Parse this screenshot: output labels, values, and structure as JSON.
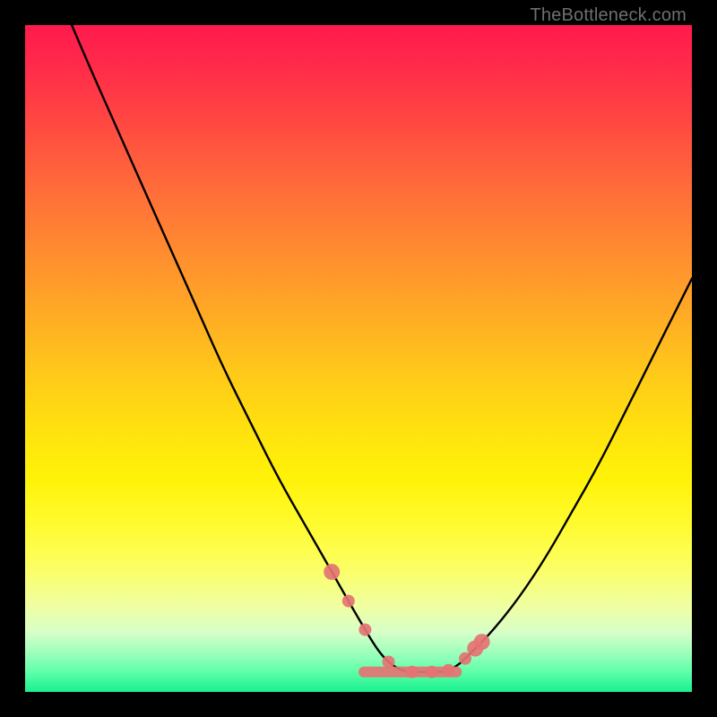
{
  "watermark": "TheBottleneck.com",
  "chart_data": {
    "type": "line",
    "title": "",
    "xlabel": "",
    "ylabel": "",
    "xlim": [
      0,
      100
    ],
    "ylim": [
      0,
      100
    ],
    "grid": false,
    "series": [
      {
        "name": "bottleneck-curve",
        "x": [
          7,
          10,
          14,
          18,
          22,
          26,
          30,
          34,
          38,
          42,
          46,
          50,
          53,
          55,
          57,
          60,
          63,
          65,
          67,
          70,
          74,
          78,
          82,
          86,
          90,
          94,
          98,
          100
        ],
        "values": [
          100,
          93,
          84,
          75,
          66,
          57,
          48,
          40,
          32,
          25,
          18,
          11,
          6,
          4,
          3,
          3,
          3,
          4,
          6,
          9,
          14,
          20,
          27,
          34,
          42,
          50,
          58,
          62
        ]
      }
    ],
    "annotations": {
      "marker_color": "#e57373",
      "marker_xs": [
        46,
        48.5,
        51,
        54.5,
        58,
        61,
        63.5,
        66,
        67.5,
        68.5
      ]
    },
    "gradient_stops": [
      {
        "pos": 0,
        "color": "#ff1a4d"
      },
      {
        "pos": 50,
        "color": "#ffce18"
      },
      {
        "pos": 80,
        "color": "#fcff60"
      },
      {
        "pos": 100,
        "color": "#18f090"
      }
    ]
  }
}
